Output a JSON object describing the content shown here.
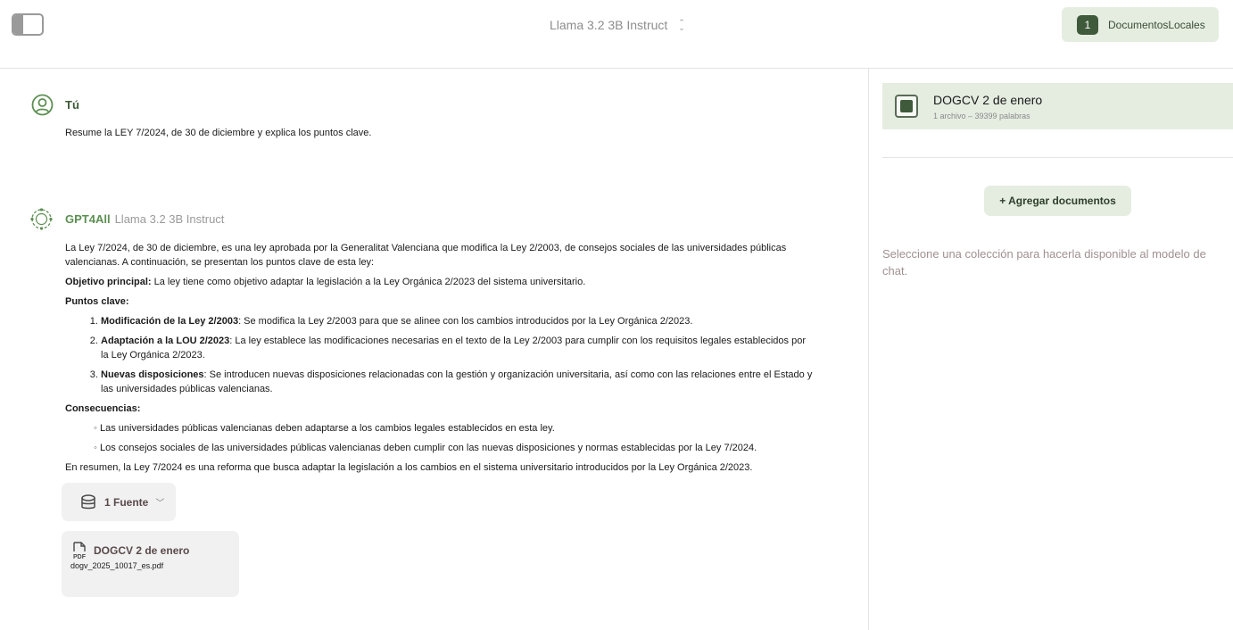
{
  "header": {
    "model_name": "Llama 3.2 3B Instruct",
    "local_docs_count": "1",
    "local_docs_label": "DocumentosLocales"
  },
  "chat": {
    "user": {
      "author": "Tú",
      "text": "Resume la LEY 7/2024, de 30 de diciembre y explica los puntos clave."
    },
    "assistant": {
      "author": "GPT4All",
      "model": "Llama 3.2 3B Instruct",
      "intro": "La Ley 7/2024, de 30 de diciembre, es una ley aprobada por la Generalitat Valenciana que modifica la Ley 2/2003, de consejos sociales de las universidades públicas valencianas. A continuación, se presentan los puntos clave de esta ley:",
      "objective_label": "Objetivo principal:",
      "objective_text": " La ley tiene como objetivo adaptar la legislación a la Ley Orgánica 2/2023 del sistema universitario.",
      "key_points_label": "Puntos clave:",
      "key_points": [
        {
          "title": "Modificación de la Ley 2/2003",
          "text": ": Se modifica la Ley 2/2003 para que se alinee con los cambios introducidos por la Ley Orgánica 2/2023."
        },
        {
          "title": "Adaptación a la LOU 2/2023",
          "text": ": La ley establece las modificaciones necesarias en el texto de la Ley 2/2003 para cumplir con los requisitos legales establecidos por la Ley Orgánica 2/2023."
        },
        {
          "title": "Nuevas disposiciones",
          "text": ": Se introducen nuevas disposiciones relacionadas con la gestión y organización universitaria, así como con las relaciones entre el Estado y las universidades públicas valencianas."
        }
      ],
      "consequences_label": "Consecuencias:",
      "consequences": [
        "Las universidades públicas valencianas deben adaptarse a los cambios legales establecidos en esta ley.",
        "Los consejos sociales de las universidades públicas valencianas deben cumplir con las nuevas disposiciones y normas establecidas por la Ley 7/2024."
      ],
      "summary": "En resumen, la Ley 7/2024 es una reforma que busca adaptar la legislación a los cambios en el sistema universitario introducidos por la Ley Orgánica 2/2023."
    },
    "sources": {
      "button_label": "1 Fuente",
      "items": [
        {
          "title": "DOGCV 2 de enero",
          "file": "dogv_2025_10017_es.pdf",
          "icon": "pdf-file-icon"
        }
      ]
    }
  },
  "panel": {
    "collection": {
      "name": "DOGCV 2 de enero",
      "meta": "1 archivo – 39399 palabras",
      "selected": true
    },
    "add_button": "+ Agregar documentos",
    "hint": "Seleccione una colección para hacerla disponible al modelo de chat."
  },
  "colors": {
    "accent": "#3f5a3a",
    "accent_light": "#e5ede1",
    "assistant_name": "#5c8f52"
  }
}
